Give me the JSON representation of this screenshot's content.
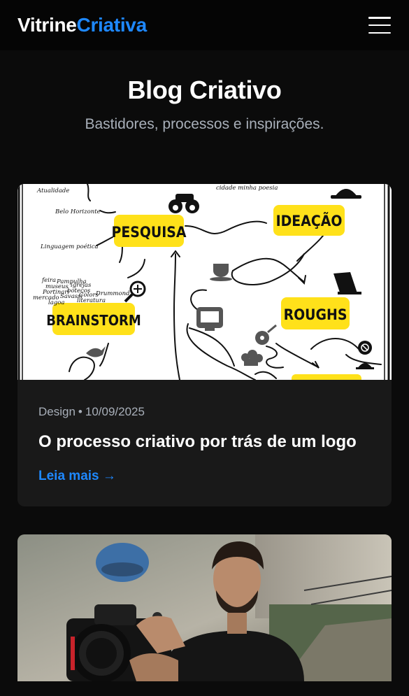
{
  "header": {
    "brand_part1": "Vitrine",
    "brand_part2": "Criativa",
    "menu_icon": "hamburger-menu-icon"
  },
  "hero": {
    "title": "Blog Criativo",
    "subtitle": "Bastidores, processos e inspirações."
  },
  "posts": [
    {
      "category": "Design",
      "separator": "•",
      "date": "10/09/2025",
      "title": "O processo criativo por trás de um logo",
      "read_more": "Leia mais →",
      "image": {
        "labels": {
          "pesquisa": "PESQUISA",
          "ideacao": "IDEAÇÃO",
          "brainstorm": "BRAINSTORM",
          "roughs": "ROUGHS"
        },
        "notes": {
          "atualidade": "Atualidade",
          "belo_horizonte": "Belo Horizonte",
          "linguagem": "Linguagem poética",
          "cidade": "cidade minha poesia",
          "feira": "feira",
          "pampulha": "Pampulha",
          "museus": "museus",
          "igrejas": "igrejas",
          "portinari": "Portinari",
          "botecos": "botecos",
          "mercado": "mercado",
          "savassi": "Savassi",
          "colors": "Colors",
          "drummond": "Drummond",
          "lagoa": "lagoa",
          "literatura": "literatura"
        }
      }
    },
    {
      "image_alt": "Fotógrafo segurando uma câmera"
    }
  ],
  "colors": {
    "accent": "#1e88ff",
    "background": "#0b0b0b",
    "card": "#191919",
    "muted": "#a8afb9",
    "highlight_yellow": "#ffe11a"
  }
}
